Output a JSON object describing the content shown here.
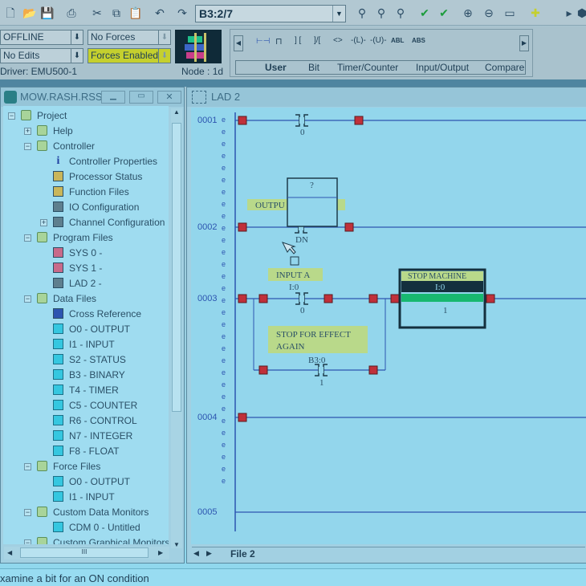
{
  "toolbar": {
    "icons": [
      "new-file-icon",
      "open-folder-icon",
      "save-icon",
      "print-icon",
      "cut-icon",
      "copy-icon",
      "paste-icon",
      "undo-icon",
      "redo-icon",
      "find-icon",
      "replace-icon",
      "cross-reference-icon",
      "verify-file-icon",
      "verify-project-icon",
      "zoom-in-icon",
      "zoom-out-icon",
      "window-icon",
      "add-icon",
      "arrow-right-icon",
      "online-icon"
    ],
    "address": "B3:2/7"
  },
  "status_panel": {
    "mode": "OFFLINE",
    "edits": "No Edits",
    "forces": "No Forces",
    "forces_enabled": "Forces Enabled",
    "driver": "Driver: EMU500-1",
    "node": "Node :  1d",
    "forces_enabled_color": "#c5d02e"
  },
  "instruction_bar": {
    "buttons": [
      "branch",
      "rung",
      "XIC",
      "XIO",
      "OTE",
      "OTL",
      "OTU",
      "ABL",
      "ABS"
    ],
    "labels": {
      "abl": "ABL",
      "abs": "ABS"
    },
    "tabs": [
      "User",
      "Bit",
      "Timer/Counter",
      "Input/Output",
      "Compare"
    ],
    "active_tab": "User"
  },
  "project_window": {
    "title": "MOW.RASH.RSS",
    "tree": [
      {
        "label": "Project",
        "level": 0,
        "icon": "folder",
        "exp": "-"
      },
      {
        "label": "Help",
        "level": 1,
        "icon": "folder",
        "exp": "+"
      },
      {
        "label": "Controller",
        "level": 1,
        "icon": "folder",
        "exp": "-"
      },
      {
        "label": "Controller Properties",
        "level": 2,
        "icon": "info"
      },
      {
        "label": "Processor Status",
        "level": 2,
        "icon": "tool"
      },
      {
        "label": "Function Files",
        "level": 2,
        "icon": "tool"
      },
      {
        "label": "IO Configuration",
        "level": 2,
        "icon": "io"
      },
      {
        "label": "Channel Configuration",
        "level": 2,
        "icon": "io",
        "exp": "+"
      },
      {
        "label": "Program Files",
        "level": 1,
        "icon": "folder",
        "exp": "-"
      },
      {
        "label": "SYS 0 -",
        "level": 2,
        "icon": "program"
      },
      {
        "label": "SYS 1 -",
        "level": 2,
        "icon": "program"
      },
      {
        "label": "LAD 2 -",
        "level": 2,
        "icon": "ladder"
      },
      {
        "label": "Data Files",
        "level": 1,
        "icon": "folder",
        "exp": "-"
      },
      {
        "label": "Cross Reference",
        "level": 2,
        "icon": "xref"
      },
      {
        "label": "O0 - OUTPUT",
        "level": 2,
        "icon": "file"
      },
      {
        "label": "I1 - INPUT",
        "level": 2,
        "icon": "file"
      },
      {
        "label": "S2 - STATUS",
        "level": 2,
        "icon": "file"
      },
      {
        "label": "B3 - BINARY",
        "level": 2,
        "icon": "file"
      },
      {
        "label": "T4 - TIMER",
        "level": 2,
        "icon": "file"
      },
      {
        "label": "C5 - COUNTER",
        "level": 2,
        "icon": "file"
      },
      {
        "label": "R6 - CONTROL",
        "level": 2,
        "icon": "file"
      },
      {
        "label": "N7 - INTEGER",
        "level": 2,
        "icon": "file"
      },
      {
        "label": "F8 - FLOAT",
        "level": 2,
        "icon": "file"
      },
      {
        "label": "Force Files",
        "level": 1,
        "icon": "folder",
        "exp": "-"
      },
      {
        "label": "O0 - OUTPUT",
        "level": 2,
        "icon": "file"
      },
      {
        "label": "I1 - INPUT",
        "level": 2,
        "icon": "file"
      },
      {
        "label": "Custom Data Monitors",
        "level": 1,
        "icon": "folder",
        "exp": "-"
      },
      {
        "label": "CDM 0 - Untitled",
        "level": 2,
        "icon": "file"
      },
      {
        "label": "Custom Graphical Monitors",
        "level": 1,
        "icon": "folder",
        "exp": "-"
      }
    ],
    "hscroll_grip": "III"
  },
  "ladder_window": {
    "title": "LAD 2",
    "file_tab": "File 2",
    "rungs": [
      "0001",
      "0002",
      "0003",
      "0004",
      "0005"
    ],
    "r1": {
      "bit": "0"
    },
    "r2": {
      "comment": "OUTPU",
      "drag_bit": "?",
      "bit": "DN"
    },
    "r3": {
      "comment_a": "INPUT A",
      "addr_a": "I:0",
      "bit_a": "0",
      "comment_b1": "STOP FOR  EFFECT",
      "comment_b2": "AGAIN",
      "addr_b": "B3:0",
      "bit_b": "1",
      "out_comment": "STOP MACHINE",
      "out_addr": "I:0",
      "out_bit": "1"
    }
  },
  "status_bar": {
    "text": "xamine a bit for an ON condition"
  }
}
